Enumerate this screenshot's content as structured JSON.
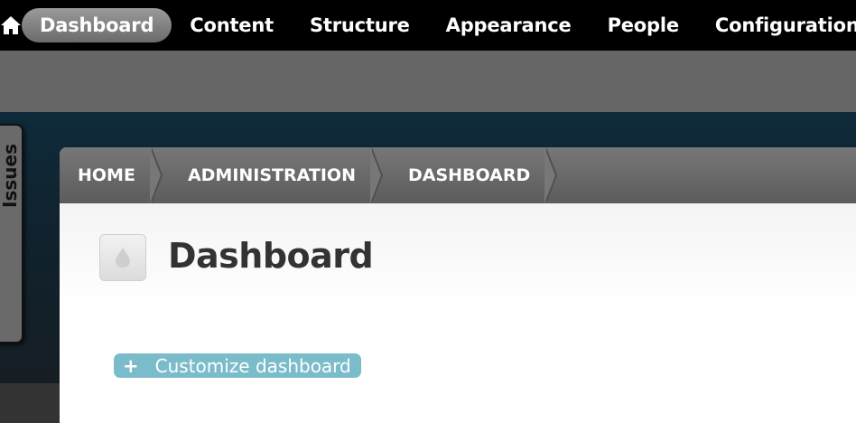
{
  "toolbar": {
    "home_icon": "home-icon",
    "items": [
      {
        "label": "Dashboard",
        "active": true
      },
      {
        "label": "Content",
        "active": false
      },
      {
        "label": "Structure",
        "active": false
      },
      {
        "label": "Appearance",
        "active": false
      },
      {
        "label": "People",
        "active": false
      },
      {
        "label": "Configuration",
        "active": false
      }
    ]
  },
  "issues_tab": {
    "label": "Issues"
  },
  "breadcrumb": [
    "HOME",
    "ADMINISTRATION",
    "DASHBOARD"
  ],
  "page": {
    "title": "Dashboard",
    "logo_icon": "drupal-drop-icon"
  },
  "customize": {
    "icon": "plus-icon",
    "label": "Customize dashboard"
  },
  "colors": {
    "toolbar_bg": "#000000",
    "shortcut_bar_bg": "#666666",
    "customize_button": "#7bbcca",
    "breadcrumb_bg": "#6b6b6b"
  }
}
